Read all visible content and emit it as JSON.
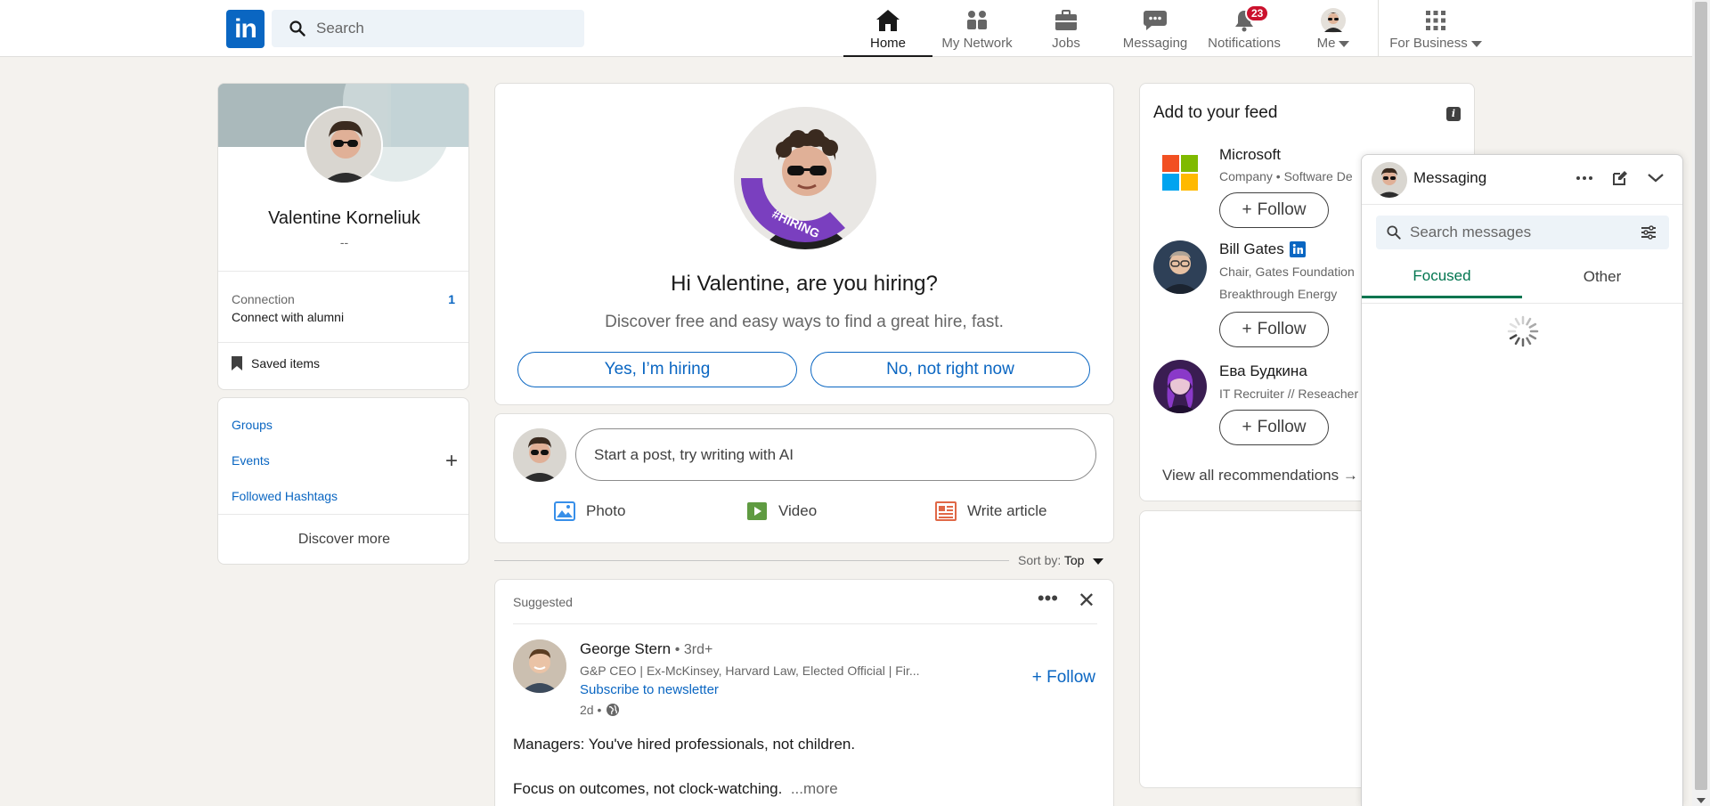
{
  "nav": {
    "logo": "in",
    "search_placeholder": "Search",
    "items": [
      {
        "label": "Home"
      },
      {
        "label": "My Network"
      },
      {
        "label": "Jobs"
      },
      {
        "label": "Messaging"
      },
      {
        "label": "Notifications",
        "badge": "23"
      },
      {
        "label": "Me"
      },
      {
        "label": "For Business"
      }
    ],
    "accent": "#0a66c2"
  },
  "profile": {
    "name": "Valentine Korneliuk",
    "headline": "--",
    "connection_label": "Connection",
    "connection_count": "1",
    "connection_sub": "Connect with alumni",
    "saved_items": "Saved items"
  },
  "links": {
    "groups": "Groups",
    "events": "Events",
    "hashtags": "Followed Hashtags",
    "discover": "Discover more"
  },
  "hiring": {
    "badge_text": "#HIRING",
    "title": "Hi Valentine, are you hiring?",
    "subtitle": "Discover free and easy ways to find a great hire, fast.",
    "yes_label": "Yes, I’m hiring",
    "no_label": "No, not right now"
  },
  "post_box": {
    "placeholder": "Start a post, try writing with AI",
    "photo": "Photo",
    "video": "Video",
    "article": "Write article"
  },
  "sort": {
    "label": "Sort by:",
    "value": "Top"
  },
  "feed_post": {
    "kicker": "Suggested",
    "author": "George Stern",
    "degree": "• 3rd+",
    "headline": "G&P CEO | Ex-McKinsey, Harvard Law, Elected Official | Fir...",
    "newsletter": "Subscribe to newsletter",
    "time": "2d •",
    "follow": "+ Follow",
    "text1": "Managers: You've hired professionals, not children.",
    "text2": "Focus on outcomes, not clock-watching.",
    "more": "...more"
  },
  "recommendations": {
    "title": "Add to your feed",
    "items": [
      {
        "name": "Microsoft",
        "desc": "Company • Software De",
        "follow": "Follow"
      },
      {
        "name": "Bill Gates",
        "desc": "Chair, Gates Foundation",
        "desc2": "Breakthrough Energy",
        "follow": "Follow"
      },
      {
        "name": "Ева Будкина",
        "desc": "IT Recruiter // Reseacher",
        "follow": "Follow"
      }
    ],
    "view_all": "View all recommendations →"
  },
  "messaging": {
    "title": "Messaging",
    "search_placeholder": "Search messages",
    "tab_focused": "Focused",
    "tab_other": "Other",
    "focused_color": "#01754f"
  }
}
